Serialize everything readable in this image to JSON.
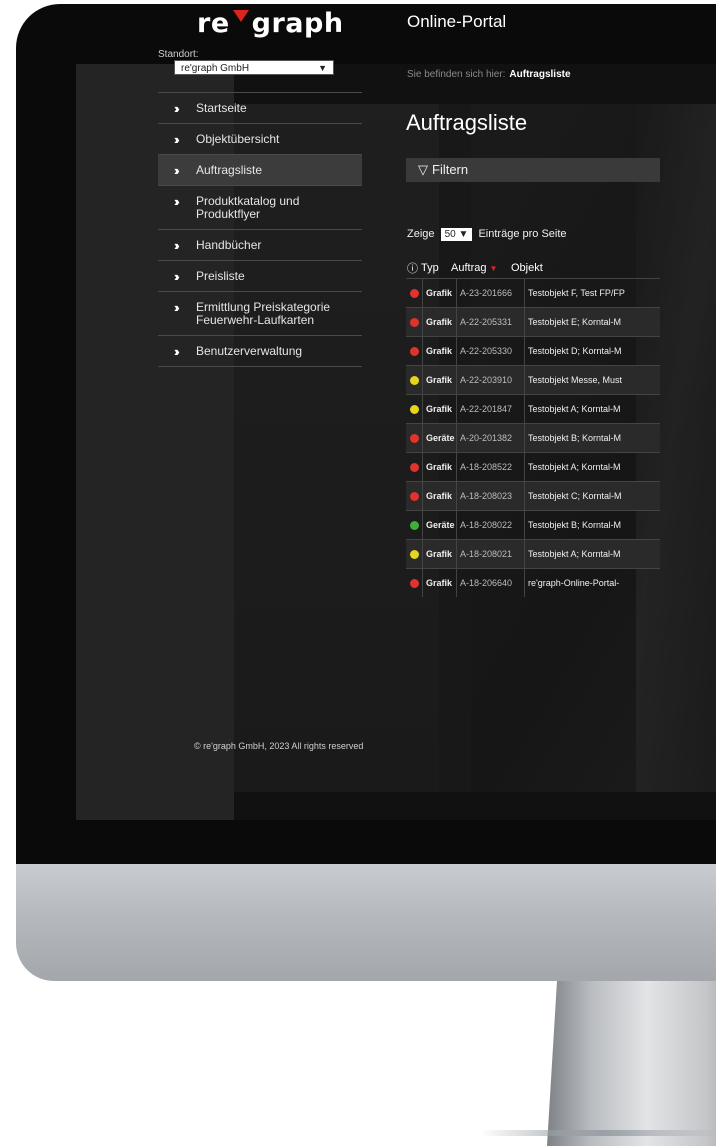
{
  "portal": {
    "logo_left": "re",
    "logo_right": "graph",
    "title": "Online-Portal",
    "brand_color": "#d9251d"
  },
  "standort": {
    "label": "Standort:",
    "value": "re'graph GmbH"
  },
  "nav": [
    {
      "label": "Startseite",
      "active": false
    },
    {
      "label": "Objektübersicht",
      "active": false
    },
    {
      "label": "Auftragsliste",
      "active": true
    },
    {
      "label": "Produktkatalog und Produktflyer",
      "active": false
    },
    {
      "label": "Handbücher",
      "active": false
    },
    {
      "label": "Preisliste",
      "active": false
    },
    {
      "label": "Ermittlung Preiskategorie Feuerwehr-Laufkarten",
      "active": false
    },
    {
      "label": "Benutzerverwaltung",
      "active": false
    }
  ],
  "breadcrumb": {
    "prefix": "Sie befinden sich hier:",
    "current": "Auftragsliste"
  },
  "page_title": "Auftragsliste",
  "filter_label": "Filtern",
  "page_size": {
    "before": "Zeige",
    "value": "50",
    "after": "Einträge pro Seite"
  },
  "table": {
    "headers": {
      "info": "ⓘ",
      "typ": "Typ",
      "auftrag": "Auftrag",
      "objekt": "Objekt"
    },
    "status_colors": {
      "red": "#e0332c",
      "yellow": "#e6d41e",
      "green": "#3fae3a"
    },
    "rows": [
      {
        "status": "red",
        "typ": "Grafik",
        "auftrag": "A-23-201666",
        "objekt": "Testobjekt F, Test FP/FP"
      },
      {
        "status": "red",
        "typ": "Grafik",
        "auftrag": "A-22-205331",
        "objekt": "Testobjekt E; Korntal-M"
      },
      {
        "status": "red",
        "typ": "Grafik",
        "auftrag": "A-22-205330",
        "objekt": "Testobjekt D; Korntal-M"
      },
      {
        "status": "yellow",
        "typ": "Grafik",
        "auftrag": "A-22-203910",
        "objekt": "Testobjekt Messe, Must"
      },
      {
        "status": "yellow",
        "typ": "Grafik",
        "auftrag": "A-22-201847",
        "objekt": "Testobjekt A; Korntal-M"
      },
      {
        "status": "red",
        "typ": "Geräte",
        "auftrag": "A-20-201382",
        "objekt": "Testobjekt B; Korntal-M"
      },
      {
        "status": "red",
        "typ": "Grafik",
        "auftrag": "A-18-208522",
        "objekt": "Testobjekt A; Korntal-M"
      },
      {
        "status": "red",
        "typ": "Grafik",
        "auftrag": "A-18-208023",
        "objekt": "Testobjekt C; Korntal-M"
      },
      {
        "status": "green",
        "typ": "Geräte",
        "auftrag": "A-18-208022",
        "objekt": "Testobjekt B; Korntal-M"
      },
      {
        "status": "yellow",
        "typ": "Grafik",
        "auftrag": "A-18-208021",
        "objekt": "Testobjekt A; Korntal-M"
      },
      {
        "status": "red",
        "typ": "Grafik",
        "auftrag": "A-18-206640",
        "objekt": "re'graph-Online-Portal-"
      }
    ]
  },
  "footer": "© re'graph GmbH, 2023 All rights reserved"
}
